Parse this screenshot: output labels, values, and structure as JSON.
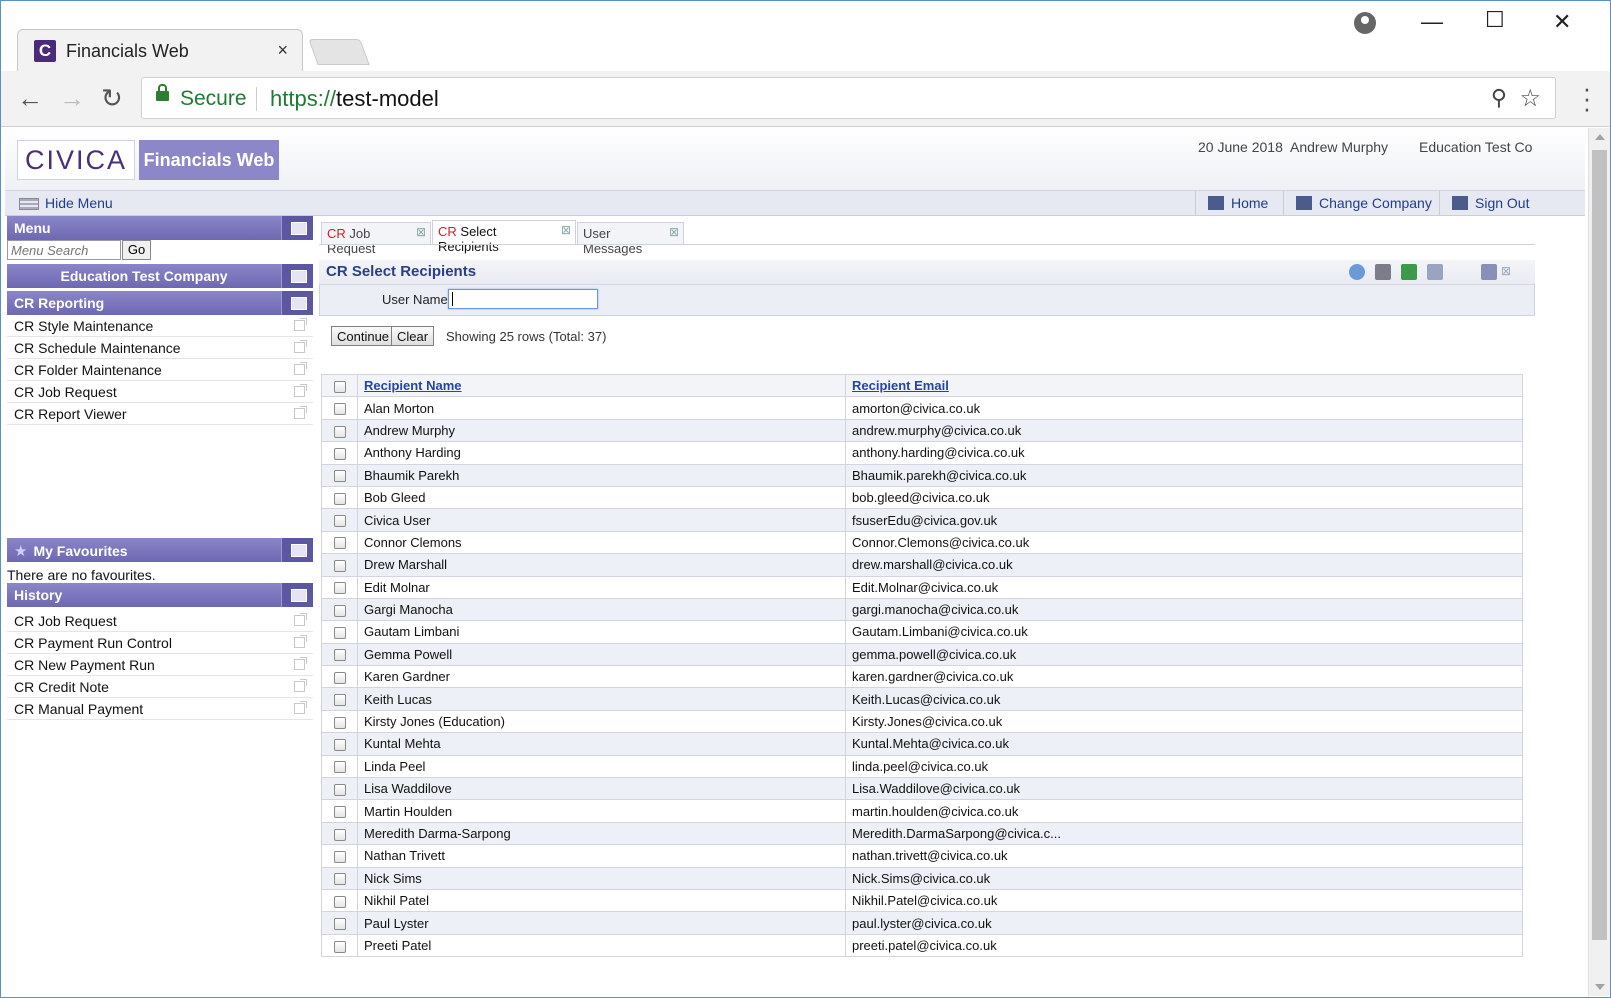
{
  "browser": {
    "tab_title": "Financials Web",
    "tab_close": "×",
    "favicon_letter": "C",
    "secure_label": "Secure",
    "url_scheme": "https://",
    "url_host": "test-model"
  },
  "header": {
    "logo_text": "CIVICA",
    "product_name": "Financials Web",
    "date": "20 June 2018",
    "user": "Andrew Murphy",
    "company": "Education Test Co"
  },
  "menubar": {
    "hide_menu": "Hide Menu",
    "home": "Home",
    "change_company": "Change Company",
    "sign_out": "Sign Out"
  },
  "sidebar": {
    "menu_title": "Menu",
    "search_placeholder": "Menu Search",
    "go_label": "Go",
    "company_name": "Education Test Company",
    "section_title": "CR Reporting",
    "items": [
      "CR Style Maintenance",
      "CR Schedule Maintenance",
      "CR Folder Maintenance",
      "CR Job Request",
      "CR Report Viewer"
    ],
    "favourites_title": "My Favourites",
    "favourites_empty": "There are no favourites.",
    "history_title": "History",
    "history": [
      "CR Job Request",
      "CR Payment Run Control",
      "CR New Payment Run",
      "CR Credit Note",
      "CR Manual Payment"
    ]
  },
  "tabs": [
    {
      "prefix": "CR",
      "label": " Job Request"
    },
    {
      "prefix": "CR",
      "label": " Select Recipients"
    },
    {
      "prefix": "",
      "label": "User Messages"
    }
  ],
  "page": {
    "title": "CR Select Recipients",
    "filter_label": "User Name",
    "filter_value": "",
    "continue_label": "Continue",
    "clear_label": "Clear",
    "rows_info": "Showing 25 rows (Total: 37)"
  },
  "table": {
    "headers": [
      "Recipient Name",
      "Recipient Email"
    ],
    "rows": [
      [
        "Alan Morton",
        "amorton@civica.co.uk"
      ],
      [
        "Andrew Murphy",
        "andrew.murphy@civica.co.uk"
      ],
      [
        "Anthony Harding",
        "anthony.harding@civica.co.uk"
      ],
      [
        "Bhaumik Parekh",
        "Bhaumik.parekh@civica.co.uk"
      ],
      [
        "Bob Gleed",
        "bob.gleed@civica.co.uk"
      ],
      [
        "Civica User",
        "fsuserEdu@civica.gov.uk"
      ],
      [
        "Connor Clemons",
        "Connor.Clemons@civica.co.uk"
      ],
      [
        "Drew Marshall",
        "drew.marshall@civica.co.uk"
      ],
      [
        "Edit Molnar",
        "Edit.Molnar@civica.co.uk"
      ],
      [
        "Gargi Manocha",
        "gargi.manocha@civica.co.uk"
      ],
      [
        "Gautam Limbani",
        "Gautam.Limbani@civica.co.uk"
      ],
      [
        "Gemma Powell",
        "gemma.powell@civica.co.uk"
      ],
      [
        "Karen Gardner",
        "karen.gardner@civica.co.uk"
      ],
      [
        "Keith Lucas",
        "Keith.Lucas@civica.co.uk"
      ],
      [
        "Kirsty Jones (Education)",
        "Kirsty.Jones@civica.co.uk"
      ],
      [
        "Kuntal Mehta",
        "Kuntal.Mehta@civica.co.uk"
      ],
      [
        "Linda Peel",
        "linda.peel@civica.co.uk"
      ],
      [
        "Lisa Waddilove",
        "Lisa.Waddilove@civica.co.uk"
      ],
      [
        "Martin Houlden",
        "martin.houlden@civica.co.uk"
      ],
      [
        "Meredith Darma-Sarpong",
        "Meredith.DarmaSarpong@civica.c..."
      ],
      [
        "Nathan Trivett",
        "nathan.trivett@civica.co.uk"
      ],
      [
        "Nick Sims",
        "Nick.Sims@civica.co.uk"
      ],
      [
        "Nikhil Patel",
        "Nikhil.Patel@civica.co.uk"
      ],
      [
        "Paul Lyster",
        "paul.lyster@civica.co.uk"
      ],
      [
        "Preeti Patel",
        "preeti.patel@civica.co.uk"
      ]
    ]
  },
  "colors": {
    "accent": "#6d68b2",
    "link": "#2444a8",
    "cr_red": "#d0202a",
    "secure_green": "#1e7b34"
  }
}
